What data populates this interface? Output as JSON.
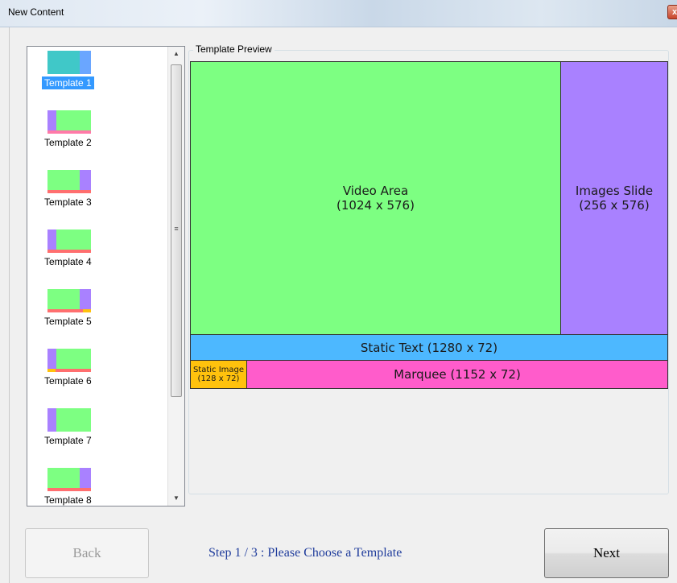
{
  "window": {
    "title": "New Content",
    "close_glyph": "x"
  },
  "template_list": {
    "items": [
      {
        "label": "Template 1",
        "selected": true
      },
      {
        "label": "Template 2",
        "selected": false
      },
      {
        "label": "Template 3",
        "selected": false
      },
      {
        "label": "Template 4",
        "selected": false
      },
      {
        "label": "Template 5",
        "selected": false
      },
      {
        "label": "Template 6",
        "selected": false
      },
      {
        "label": "Template 7",
        "selected": false
      },
      {
        "label": "Template 8",
        "selected": false
      }
    ],
    "scroll_up_glyph": "▲",
    "scroll_down_glyph": "▼",
    "scroll_grip_glyph": "≡"
  },
  "preview": {
    "title": "Template Preview",
    "zones": {
      "video": {
        "name": "Video Area",
        "size": "(1024 x 576)",
        "color": "#7dff82"
      },
      "images": {
        "name": "Images Slide",
        "size": "(256 x 576)",
        "color": "#a981ff"
      },
      "static_text": {
        "name": "Static Text",
        "size": "(1280 x 72)",
        "color": "#4db8ff"
      },
      "static_image": {
        "name": "Static Image",
        "size": "(128 x 72)",
        "color": "#ffc20d"
      },
      "marquee": {
        "name": "Marquee",
        "size": "(1152 x 72)",
        "color": "#ff5ccb"
      }
    }
  },
  "footer": {
    "back_label": "Back",
    "next_label": "Next",
    "step_text": "Step 1 / 3 : Please Choose a Template"
  }
}
